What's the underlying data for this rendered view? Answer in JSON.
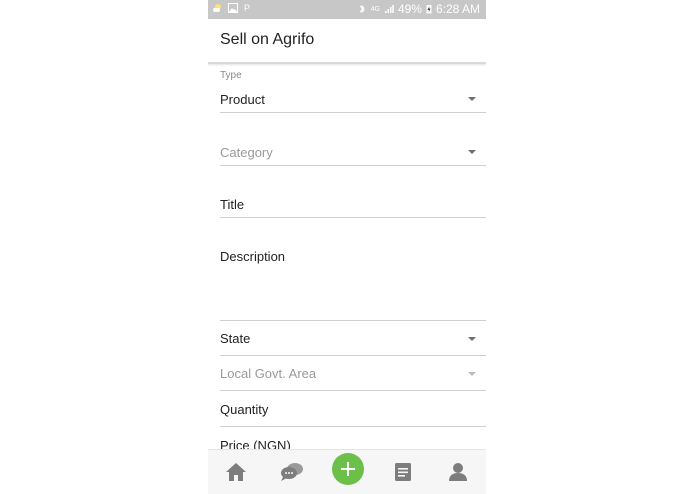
{
  "status_bar": {
    "battery": "49%",
    "time": "6:28 AM",
    "network": "4G",
    "left_letter": "P"
  },
  "app_bar": {
    "title": "Sell on Agrifo"
  },
  "form": {
    "type_label": "Type",
    "type_value": "Product",
    "category_placeholder": "Category",
    "title_label": "Title",
    "description_label": "Description",
    "state_label": "State",
    "lga_placeholder": "Local Govt. Area",
    "quantity_label": "Quantity",
    "price_label": "Price (NGN)"
  },
  "bottom_nav": {
    "items": [
      {
        "icon": "home-icon"
      },
      {
        "icon": "chat-icon"
      },
      {
        "icon": "add-icon"
      },
      {
        "icon": "document-icon"
      },
      {
        "icon": "profile-icon"
      }
    ]
  },
  "colors": {
    "accent": "#6cc04a",
    "status_bar": "#c7c7c7",
    "icon_gray": "#7d7d7d"
  }
}
